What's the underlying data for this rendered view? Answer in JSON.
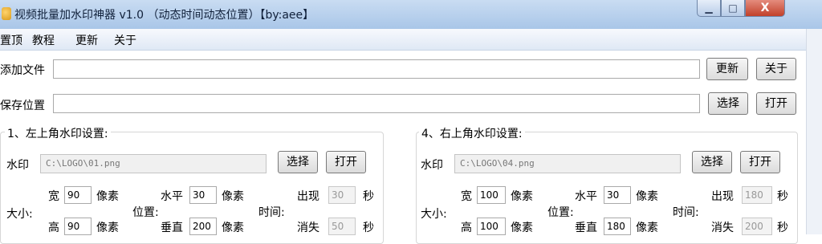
{
  "window": {
    "title": "视频批量加水印神器 v1.0 （动态时间动态位置）【by:aee】",
    "min_label": "▁",
    "max_label": "□",
    "close_label": "X"
  },
  "menu": {
    "items": [
      "置顶",
      "教程",
      "更新",
      "关于"
    ]
  },
  "add_file": {
    "label": "添加文件",
    "value": "",
    "update_label": "更新",
    "about_label": "关于"
  },
  "save_location": {
    "label": "保存位置",
    "value": "",
    "choose_label": "选择",
    "open_label": "打开"
  },
  "groups": [
    {
      "title": "1、左上角水印设置:",
      "watermark_label": "水印",
      "watermark_path": "C:\\LOGO\\01.png",
      "choose_label": "选择",
      "open_label": "打开",
      "size_label": "大小:",
      "width_label": "宽",
      "width_value": "90",
      "height_label": "高",
      "height_value": "90",
      "unit": "像素",
      "position_label": "位置:",
      "horizontal_label": "水平",
      "horizontal_value": "30",
      "vertical_label": "垂直",
      "vertical_value": "200",
      "time_label": "时间:",
      "appear_label": "出现",
      "appear_value": "30",
      "disappear_label": "消失",
      "disappear_value": "50",
      "seconds": "秒"
    },
    {
      "title": "4、右上角水印设置:",
      "watermark_label": "水印",
      "watermark_path": "C:\\LOGO\\04.png",
      "choose_label": "选择",
      "open_label": "打开",
      "size_label": "大小:",
      "width_label": "宽",
      "width_value": "100",
      "height_label": "高",
      "height_value": "100",
      "unit": "像素",
      "position_label": "位置:",
      "horizontal_label": "水平",
      "horizontal_value": "30",
      "vertical_label": "垂直",
      "vertical_value": "180",
      "time_label": "时间:",
      "appear_label": "出现",
      "appear_value": "180",
      "disappear_label": "消失",
      "disappear_value": "200",
      "seconds": "秒"
    }
  ]
}
